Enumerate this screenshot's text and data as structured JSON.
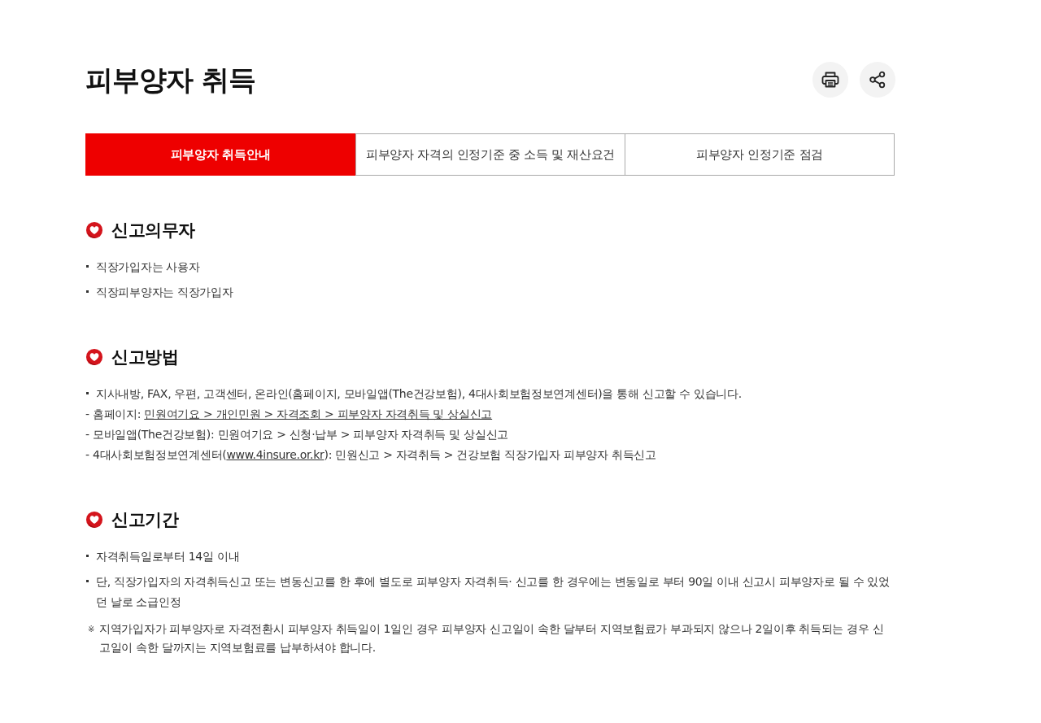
{
  "page": {
    "title": "피부양자 취득"
  },
  "tabs": [
    {
      "label": "피부양자 취득안내",
      "selected": true
    },
    {
      "label": "피부양자 자격의 인정기준 중 소득 및 재산요건",
      "selected": false
    },
    {
      "label": "피부양자 인정기준 점검",
      "selected": false
    }
  ],
  "sections": [
    {
      "title": "신고의무자",
      "items": [
        {
          "kind": "bullet",
          "parts": [
            {
              "text": "직장가입자는 사용자",
              "link": false
            }
          ]
        },
        {
          "kind": "bullet",
          "parts": [
            {
              "text": "직장피부양자는 직장가입자",
              "link": false
            }
          ]
        }
      ]
    },
    {
      "title": "신고방법",
      "items": [
        {
          "kind": "bullet",
          "parts": [
            {
              "text": "지사내방, FAX, 우편, 고객센터, 온라인(홈페이지, 모바일앱(The건강보험), 4대사회보험정보연계센터)을 통해 신고할 수 있습니다.",
              "link": false
            }
          ]
        },
        {
          "kind": "line",
          "parts": [
            {
              "text": "- 홈페이지: ",
              "link": false
            },
            {
              "text": "민원여기요 > 개인민원 > 자격조회 > 피부양자 자격취득 및 상실신고",
              "link": true
            }
          ]
        },
        {
          "kind": "line",
          "parts": [
            {
              "text": "- 모바일앱(The건강보험): 민원여기요 > 신청·납부 > 피부양자 자격취득 및 상실신고",
              "link": false
            }
          ]
        },
        {
          "kind": "line",
          "parts": [
            {
              "text": "- 4대사회보험정보연계센터(",
              "link": false
            },
            {
              "text": "www.4insure.or.kr",
              "link": true
            },
            {
              "text": "): 민원신고 > 자격취득 > 건강보험 직장가입자 피부양자 취득신고",
              "link": false
            }
          ]
        }
      ]
    },
    {
      "title": "신고기간",
      "items": [
        {
          "kind": "bullet",
          "parts": [
            {
              "text": "자격취득일로부터 14일 이내",
              "link": false
            }
          ]
        },
        {
          "kind": "bullet",
          "parts": [
            {
              "text": "단, 직장가입자의 자격취득신고 또는 변동신고를 한 후에 별도로 피부양자 자격취득· 신고를 한 경우에는 변동일로 부터 90일 이내 신고시 피부양자로 될 수 있었던 날로 소급인정",
              "link": false
            }
          ]
        },
        {
          "kind": "note",
          "mark": "※",
          "parts": [
            {
              "text": "지역가입자가 피부양자로 자격전환시 피부양자 취득일이 1일인 경우 피부양자 신고일이 속한 달부터 지역보험료가 부과되지 않으나 2일이후 취득되는 경우 신고일이 속한 달까지는 지역보험료를 납부하셔야 합니다.",
              "link": false
            }
          ]
        }
      ]
    }
  ]
}
